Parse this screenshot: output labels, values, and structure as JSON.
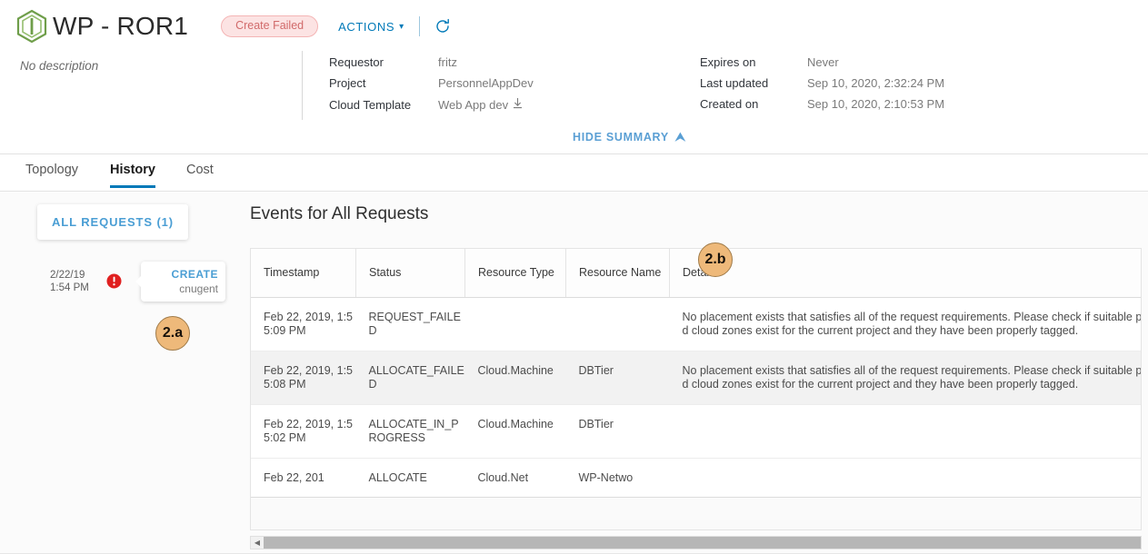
{
  "header": {
    "logo_icon": "cube-hexagon-icon",
    "title": "WP - ROR1",
    "status_badge": "Create Failed",
    "actions_label": "ACTIONS",
    "actions_caret_icon": "chevron-down-icon",
    "refresh_icon": "refresh-icon",
    "description": "No description",
    "hide_summary_label": "HIDE SUMMARY",
    "hide_summary_icon": "chevron-up-icon",
    "meta_left": [
      {
        "label": "Requestor",
        "value": "fritz"
      },
      {
        "label": "Project",
        "value": "PersonnelAppDev"
      },
      {
        "label": "Cloud Template",
        "value": "Web App dev",
        "icon": "download-icon"
      }
    ],
    "meta_right": [
      {
        "label": "Expires on",
        "value": "Never"
      },
      {
        "label": "Last updated",
        "value": "Sep 10, 2020, 2:32:24 PM"
      },
      {
        "label": "Created on",
        "value": "Sep 10, 2020, 2:10:53 PM"
      }
    ]
  },
  "tabs": [
    {
      "label": "Topology",
      "active": false
    },
    {
      "label": "History",
      "active": true
    },
    {
      "label": "Cost",
      "active": false
    }
  ],
  "sidebar": {
    "all_requests_label": "ALL REQUESTS (1)",
    "timeline_entry": {
      "date": "2/22/19",
      "time": "1:54 PM",
      "status_icon": "error-icon",
      "card_title": "CREATE",
      "card_user": "cnugent"
    }
  },
  "events": {
    "title": "Events for All Requests",
    "columns": [
      "Timestamp",
      "Status",
      "Resource Type",
      "Resource Name",
      "Details"
    ],
    "rows": [
      {
        "timestamp": "Feb 22, 2019, 1:55:09 PM",
        "status": "REQUEST_FAILED",
        "resource_type": "",
        "resource_name": "",
        "details": "No placement exists that satisfies all of the request requirements. Please check if suitable placements and cloud zones exist for the current project and they have been properly tagged."
      },
      {
        "timestamp": "Feb 22, 2019, 1:55:08 PM",
        "status": "ALLOCATE_FAILED",
        "resource_type": "Cloud.Machine",
        "resource_name": "DBTier",
        "details": "No placement exists that satisfies all of the request requirements. Please check if suitable placements and cloud zones exist for the current project and they have been properly tagged."
      },
      {
        "timestamp": "Feb 22, 2019, 1:55:02 PM",
        "status": "ALLOCATE_IN_PROGRESS",
        "resource_type": "Cloud.Machine",
        "resource_name": "DBTier",
        "details": ""
      },
      {
        "timestamp": "Feb 22, 201",
        "status": "ALLOCATE",
        "resource_type": "Cloud.Net",
        "resource_name": "WP-Netwo",
        "details": ""
      }
    ],
    "hscroll_arrow_icon": "chevron-left-icon"
  },
  "callouts": [
    {
      "label": "2.a"
    },
    {
      "label": "2.b"
    }
  ],
  "colors": {
    "accent_blue": "#0079b8",
    "link_blue": "#4a9ed4",
    "status_badge_bg": "#fce3e3",
    "status_badge_text": "#d16a6a",
    "error_red": "#e02020",
    "callout_fill": "#eeb97a",
    "logo_green": "#6f9e4a",
    "row_alt_bg": "#f2f2f2"
  }
}
